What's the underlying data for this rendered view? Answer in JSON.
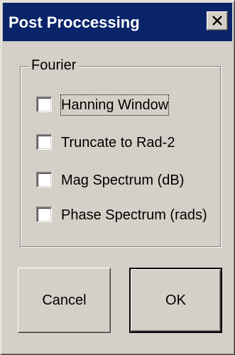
{
  "window": {
    "title": "Post Proccessing",
    "close_label": "Close"
  },
  "group": {
    "legend": "Fourier",
    "options": [
      {
        "label": "Hanning Window",
        "checked": false
      },
      {
        "label": "Truncate to Rad-2",
        "checked": false
      },
      {
        "label": "Mag Spectrum (dB)",
        "checked": false
      },
      {
        "label": "Phase Spectrum (rads)",
        "checked": false
      }
    ]
  },
  "buttons": {
    "cancel_label": "Cancel",
    "ok_label": "OK"
  },
  "colors": {
    "titlebar": "#0a246a",
    "face": "#d4d0c8"
  }
}
